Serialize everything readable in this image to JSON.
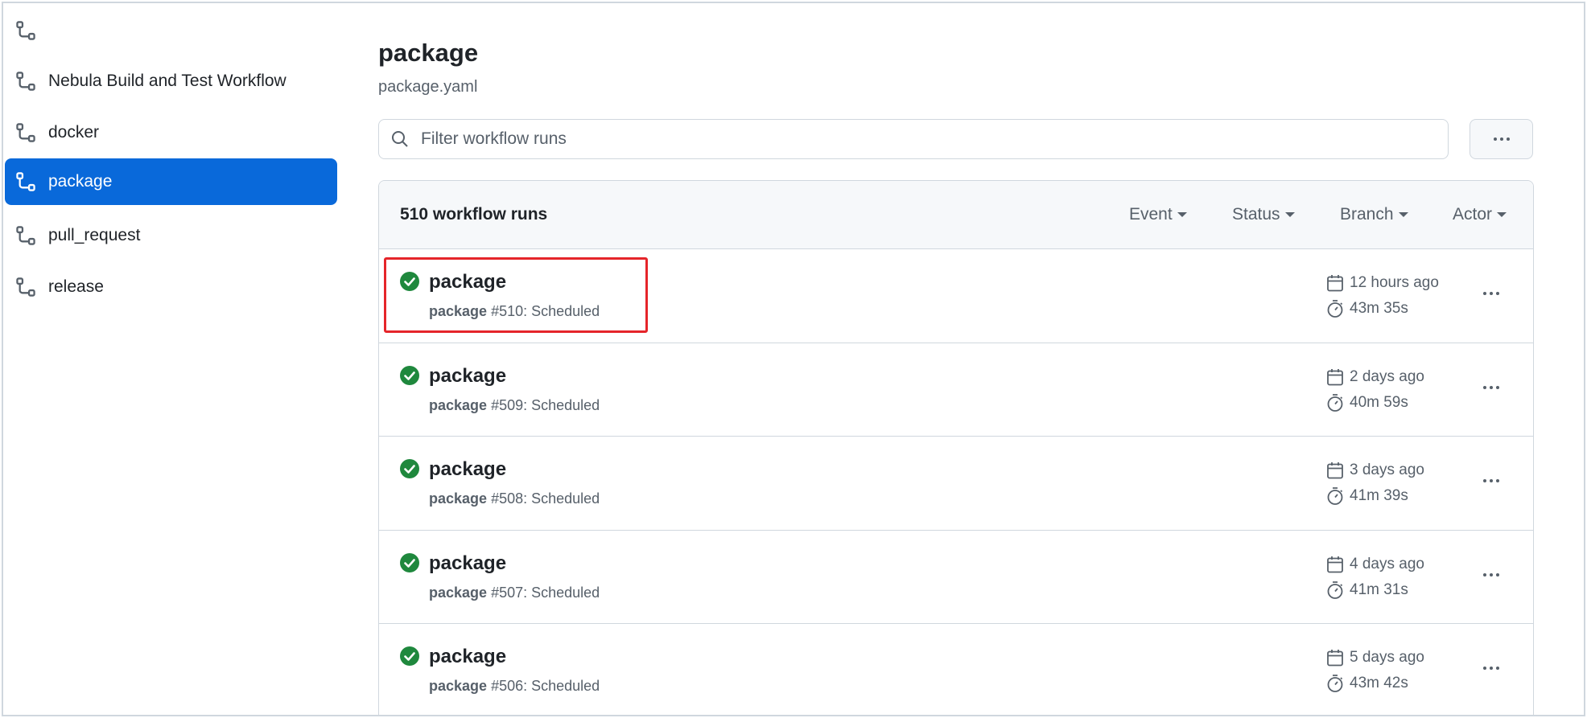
{
  "sidebar": {
    "items": [
      {
        "label": "",
        "icon": "workflow-icon",
        "active": false
      },
      {
        "label": "Nebula Build and Test Workflow",
        "icon": "workflow-icon",
        "active": false
      },
      {
        "label": "docker",
        "icon": "workflow-icon",
        "active": false
      },
      {
        "label": "package",
        "icon": "workflow-icon",
        "active": true
      },
      {
        "label": "pull_request",
        "icon": "workflow-icon",
        "active": false
      },
      {
        "label": "release",
        "icon": "workflow-icon",
        "active": false
      }
    ]
  },
  "main": {
    "title": "package",
    "subtitle": "package.yaml",
    "search": {
      "placeholder": "Filter workflow runs",
      "value": ""
    },
    "runs_count": "510 workflow runs",
    "filters": [
      "Event",
      "Status",
      "Branch",
      "Actor"
    ],
    "runs": [
      {
        "title": "package",
        "workflow": "package",
        "run": "#510: Scheduled",
        "when": "12 hours ago",
        "duration": "43m 35s",
        "status": "success",
        "highlighted": true
      },
      {
        "title": "package",
        "workflow": "package",
        "run": "#509: Scheduled",
        "when": "2 days ago",
        "duration": "40m 59s",
        "status": "success",
        "highlighted": false
      },
      {
        "title": "package",
        "workflow": "package",
        "run": "#508: Scheduled",
        "when": "3 days ago",
        "duration": "41m 39s",
        "status": "success",
        "highlighted": false
      },
      {
        "title": "package",
        "workflow": "package",
        "run": "#507: Scheduled",
        "when": "4 days ago",
        "duration": "41m 31s",
        "status": "success",
        "highlighted": false
      },
      {
        "title": "package",
        "workflow": "package",
        "run": "#506: Scheduled",
        "when": "5 days ago",
        "duration": "43m 42s",
        "status": "success",
        "highlighted": false
      }
    ]
  },
  "colors": {
    "accent": "#0969da",
    "success": "#1f883d",
    "highlight": "#e5252a",
    "muted_text": "#57606a",
    "border": "#d0d7de"
  }
}
